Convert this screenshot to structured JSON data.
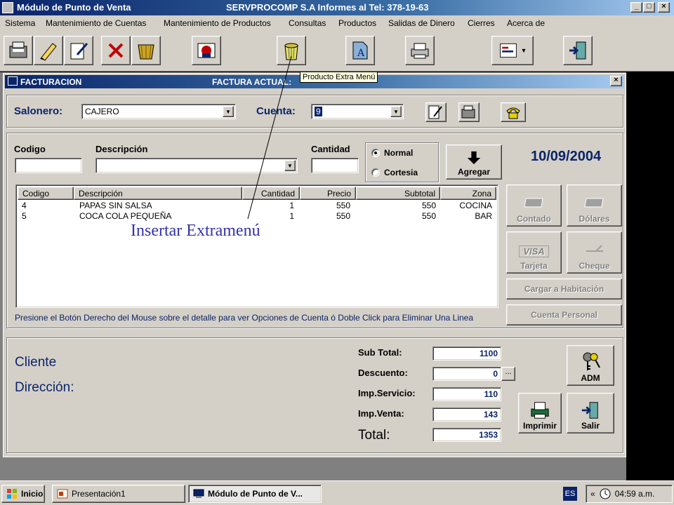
{
  "window": {
    "title": "Módulo de Punto de Venta",
    "company": "SERVPROCOMP S.A  Informes al Tel:  378-19-63",
    "min": "_",
    "max": "□",
    "close": "×"
  },
  "menu": [
    "Sistema",
    "Mantenimiento de Cuentas",
    "Mantenimiento de Productos",
    "Consultas",
    "Productos",
    "Salidas de Dinero",
    "Cierres",
    "Acerca de"
  ],
  "tooltip": "Producto Extra Menú",
  "annotation": "Insertar Extramenú",
  "child": {
    "title": "FACTURACION",
    "factura": "FACTURA ACTUAL:",
    "close": "×",
    "salonero_label": "Salonero:",
    "salonero_value": "CAJERO",
    "cuenta_label": "Cuenta:",
    "cuenta_value": "9",
    "codigo_label": "Codigo",
    "descripcion_label": "Descripción",
    "cantidad_label": "Cantidad",
    "normal": "Normal",
    "cortesia": "Cortesia",
    "agregar": "Agregar",
    "date": "10/09/2004",
    "columns": [
      "Codigo",
      "Descripción",
      "Cantidad",
      "Precio",
      "Subtotal",
      "Zona"
    ],
    "rows": [
      [
        "4",
        "PAPAS SIN SALSA",
        "1",
        "550",
        "550",
        "COCINA"
      ],
      [
        "5",
        "COCA COLA PEQUEÑA",
        "1",
        "550",
        "550",
        "BAR"
      ]
    ],
    "hint": "Presione el Botón Derecho del Mouse sobre el detalle para ver Opciones de Cuenta ó Doble Click para Eliminar Una Linea",
    "contado": "Contado",
    "dolares": "Dólares",
    "tarjeta": "Tarjeta",
    "visa": "VISA",
    "cheque": "Cheque",
    "cargar": "Cargar a Habitación",
    "cuenta_personal": "Cuenta Personal",
    "cliente": "Cliente",
    "direccion": "Dirección:",
    "subtotal_label": "Sub Total:",
    "subtotal": "1100",
    "descuento_label": "Descuento:",
    "descuento": "0",
    "descuento_btn": "...",
    "servicio_label": "Imp.Servicio:",
    "servicio": "110",
    "venta_label": "Imp.Venta:",
    "venta": "143",
    "total_label": "Total:",
    "total": "1353",
    "adm": "ADM",
    "imprimir": "Imprimir",
    "salir": "Salir"
  },
  "taskbar": {
    "start": "Inicio",
    "task1": "Presentación1",
    "task2": "Módulo de Punto de V...",
    "lang": "ES",
    "arrows": "«",
    "time": "04:59 a.m."
  }
}
